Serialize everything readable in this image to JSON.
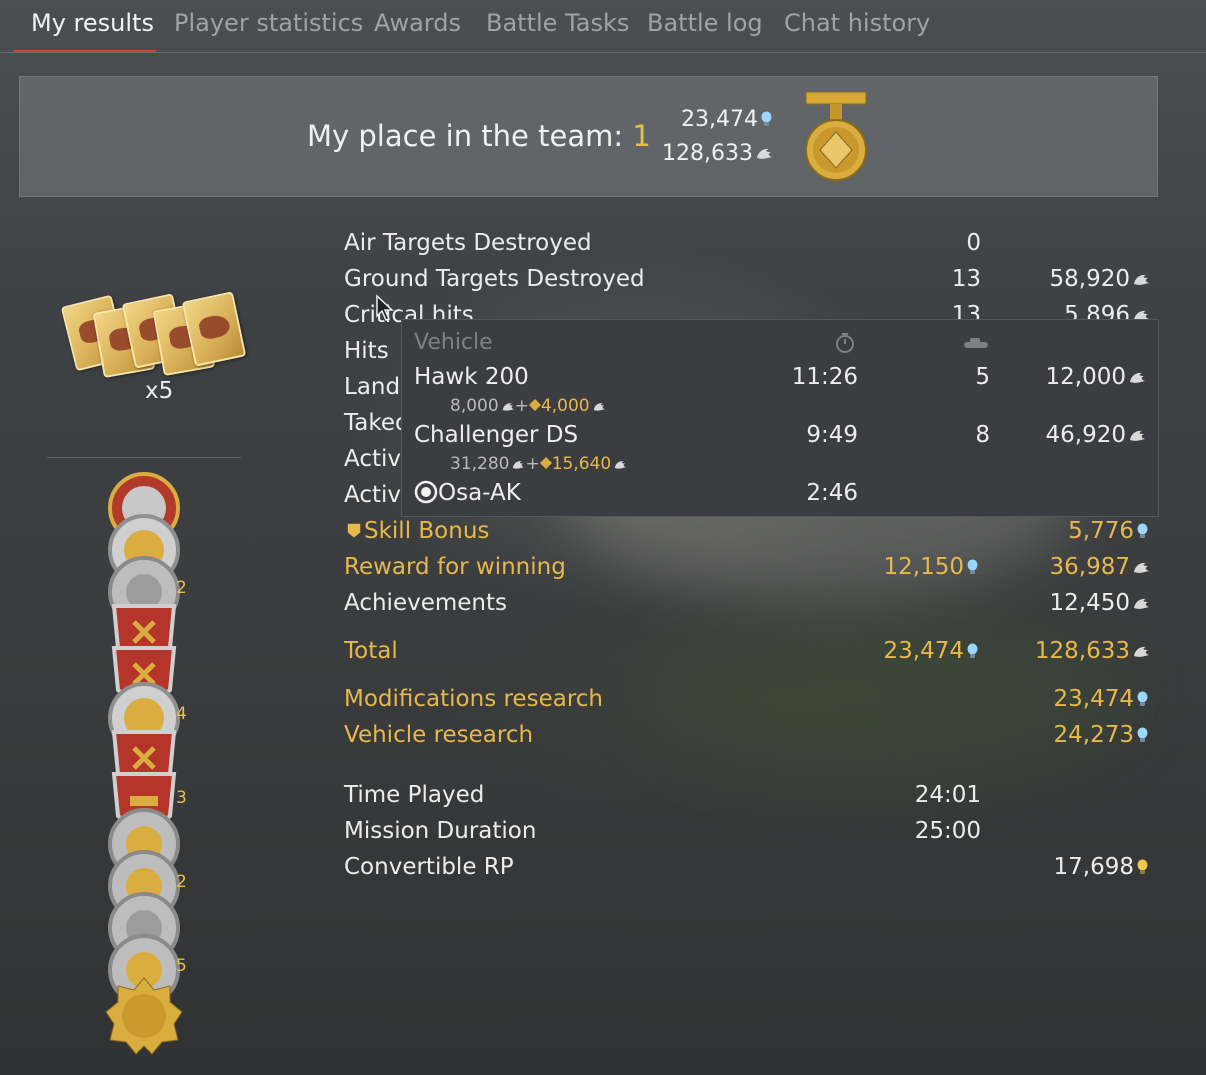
{
  "tabs": [
    {
      "label": "My results",
      "active": true
    },
    {
      "label": "Player statistics",
      "active": false
    },
    {
      "label": "Awards",
      "active": false
    },
    {
      "label": "Battle Tasks",
      "active": false
    },
    {
      "label": "Battle log",
      "active": false
    },
    {
      "label": "Chat history",
      "active": false
    }
  ],
  "header": {
    "place_label": "My place in the team: ",
    "place_value": "1",
    "rp_total": "23,474",
    "sl_total": "128,633"
  },
  "left_panel": {
    "cards_multiplier": "x5",
    "medal_counts": [
      "2",
      "4",
      "3",
      "2",
      "5"
    ]
  },
  "rows": [
    {
      "label": "Air Targets Destroyed",
      "count": "0",
      "sl": ""
    },
    {
      "label": "Ground Targets Destroyed",
      "count": "13",
      "sl": "58,920"
    },
    {
      "label": "Critical hits",
      "count": "13",
      "sl": "5,896"
    },
    {
      "label": "Hits",
      "count": "",
      "sl": ""
    },
    {
      "label": "Landings",
      "count": "",
      "sl": ""
    },
    {
      "label": "Takeoffs",
      "count": "",
      "sl": ""
    },
    {
      "label": "Activity",
      "count": "",
      "sl": ""
    },
    {
      "label": "Activity",
      "count": "",
      "sl": ""
    }
  ],
  "bonus_rows": {
    "skill_bonus": {
      "label": "Skill Bonus",
      "rp": "5,776"
    },
    "winning": {
      "label": "Reward for winning",
      "rp": "12,150",
      "sl": "36,987"
    },
    "achievements": {
      "label": "Achievements",
      "sl": "12,450"
    },
    "total": {
      "label": "Total",
      "rp": "23,474",
      "sl": "128,633"
    },
    "mod_research": {
      "label": "Modifications research",
      "rp": "23,474"
    },
    "veh_research": {
      "label": "Vehicle research",
      "rp": "24,273"
    }
  },
  "time_rows": {
    "time_played": {
      "label": "Time Played",
      "value": "24:01"
    },
    "mission_duration": {
      "label": "Mission Duration",
      "value": "25:00"
    },
    "convertible_rp": {
      "label": "Convertible RP",
      "value": "17,698"
    }
  },
  "tooltip": {
    "header_vehicle": "Vehicle",
    "vehicles": [
      {
        "name": "Hawk 200",
        "time": "11:26",
        "kills": "5",
        "sl": "12,000",
        "base": "8,000",
        "bonus": "4,000"
      },
      {
        "name": "Challenger DS",
        "time": "9:49",
        "kills": "8",
        "sl": "46,920",
        "base": "31,280",
        "bonus": "15,640"
      },
      {
        "name": "Osa-AK",
        "time": "2:46",
        "kills": "",
        "sl": "",
        "base": "",
        "bonus": ""
      }
    ]
  },
  "colors": {
    "accent_gold": "#e7b84b",
    "tab_underline": "#c24a2a",
    "rp_blue": "#8fd0ff"
  }
}
